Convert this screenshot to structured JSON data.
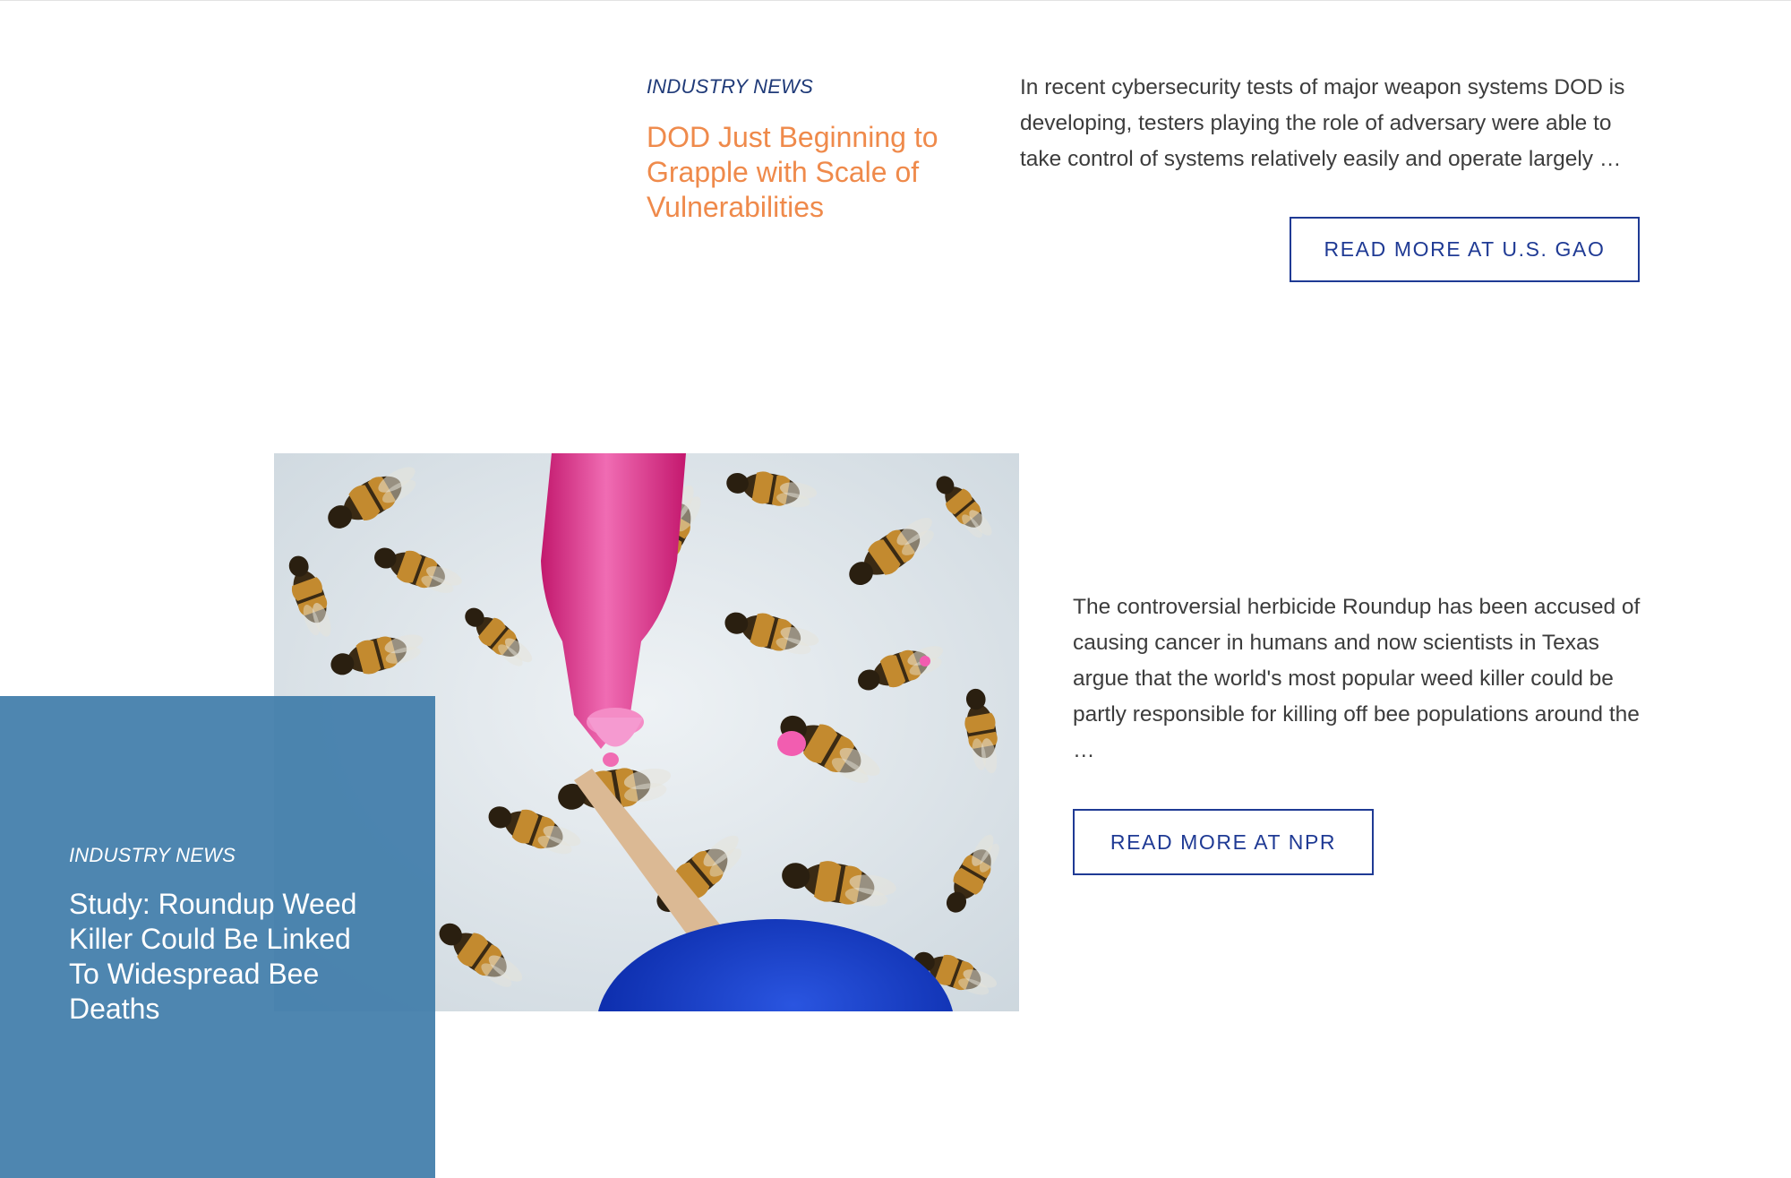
{
  "articles": [
    {
      "category": "INDUSTRY NEWS",
      "title": "DOD Just Beginning to Grapple with Scale of Vulnerabilities",
      "excerpt": "In recent cybersecurity tests of major weapon systems DOD is developing, testers playing the role of adversary were able to take control of systems relatively easily and operate largely …",
      "button_label": "READ MORE AT U.S. GAO"
    },
    {
      "category": "INDUSTRY NEWS",
      "title": "Study: Roundup Weed Killer Could Be Linked To Widespread Bee Deaths",
      "excerpt": "The controversial herbicide Roundup has been accused of causing cancer in humans and now scientists in Texas argue that the world's most popular weed killer could be partly responsible for killing off bee populations around the …",
      "button_label": "READ MORE AT NPR",
      "image_subject": "bees-marked-with-pink-paint-marker"
    }
  ],
  "colors": {
    "category_text": "#1f3a78",
    "headline_orange": "#ef8a4b",
    "button_border": "#1f3a94",
    "overlay_blue": "#3f7ca9",
    "body_text": "#3c3c3c"
  }
}
